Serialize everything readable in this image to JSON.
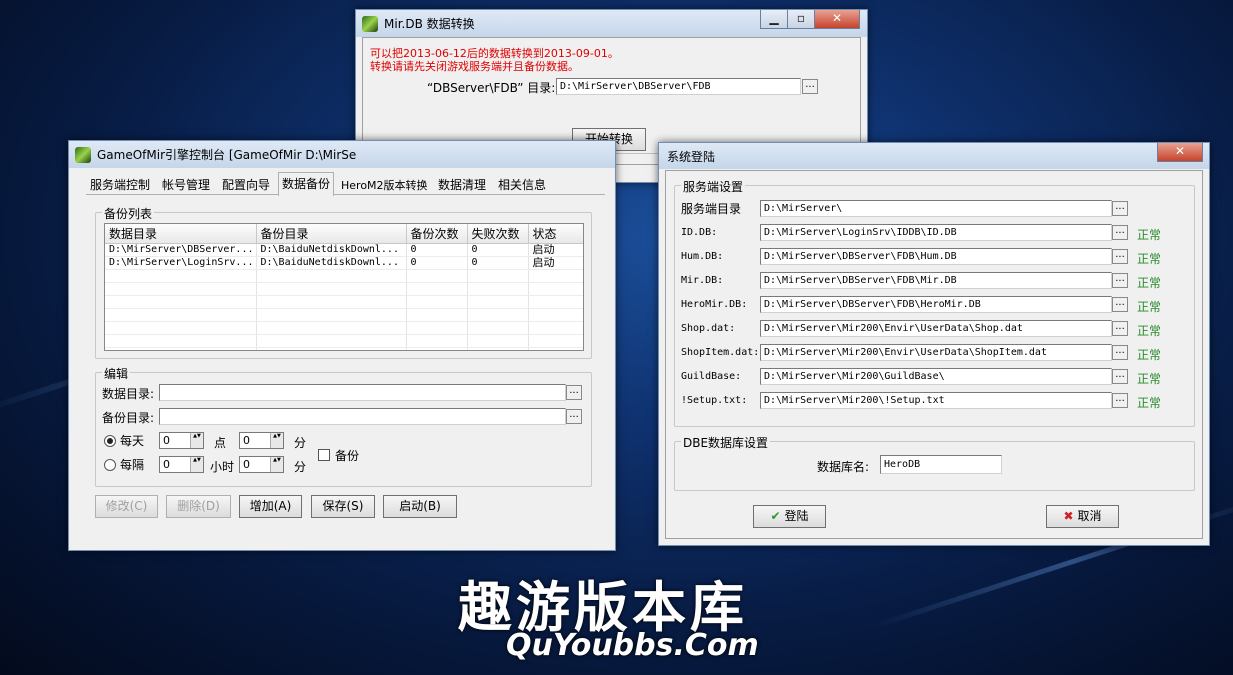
{
  "mirdb": {
    "title": "Mir.DB 数据转换",
    "notice_line1": "可以把2013-06-12后的数据转换到2013-09-01。",
    "notice_line2": "转换请请先关闭游戏服务端并且备份数据。",
    "dir_label": "“DBServer\\FDB” 目录:",
    "dir_value": "D:\\MirServer\\DBServer\\FDB",
    "browse": "...",
    "start_button": "开始转换"
  },
  "console": {
    "title": "GameOfMir引擎控制台 [GameOfMir D:\\MirSe",
    "tabs": [
      "服务端控制",
      "帐号管理",
      "配置向导",
      "数据备份",
      "HeroM2版本转换",
      "数据清理",
      "相关信息"
    ],
    "backup_list_title": "备份列表",
    "columns": [
      "数据目录",
      "备份目录",
      "备份次数",
      "失败次数",
      "状态"
    ],
    "rows": [
      [
        "D:\\MirServer\\DBServer...",
        "D:\\BaiduNetdiskDownl...",
        "0",
        "0",
        "启动"
      ],
      [
        "D:\\MirServer\\LoginSrv...",
        "D:\\BaiduNetdiskDownl...",
        "0",
        "0",
        "启动"
      ]
    ],
    "edit_title": "编辑",
    "data_dir_label": "数据目录:",
    "backup_dir_label": "备份目录:",
    "data_dir_value": "",
    "backup_dir_value": "",
    "daily_label": "每天",
    "interval_label": "每隔",
    "hour_label": "点",
    "hours_label": "小时",
    "minute_label": "分",
    "daily_hour": "0",
    "daily_minute": "0",
    "interval_hour": "0",
    "interval_minute": "0",
    "backup_check_label": "备份",
    "buttons": {
      "modify": "修改(C)",
      "delete": "删除(D)",
      "add": "增加(A)",
      "save": "保存(S)",
      "start": "启动(B)"
    }
  },
  "login": {
    "title": "系统登陆",
    "server_group": "服务端设置",
    "fields": [
      {
        "label": "服务端目录",
        "value": "D:\\MirServer\\",
        "status": ""
      },
      {
        "label": "ID.DB:",
        "value": "D:\\MirServer\\LoginSrv\\IDDB\\ID.DB",
        "status": "正常"
      },
      {
        "label": "Hum.DB:",
        "value": "D:\\MirServer\\DBServer\\FDB\\Hum.DB",
        "status": "正常"
      },
      {
        "label": "Mir.DB:",
        "value": "D:\\MirServer\\DBServer\\FDB\\Mir.DB",
        "status": "正常"
      },
      {
        "label": "HeroMir.DB:",
        "value": "D:\\MirServer\\DBServer\\FDB\\HeroMir.DB",
        "status": "正常"
      },
      {
        "label": "Shop.dat:",
        "value": "D:\\MirServer\\Mir200\\Envir\\UserData\\Shop.dat",
        "status": "正常"
      },
      {
        "label": "ShopItem.dat:",
        "value": "D:\\MirServer\\Mir200\\Envir\\UserData\\ShopItem.dat",
        "status": "正常"
      },
      {
        "label": "GuildBase:",
        "value": "D:\\MirServer\\Mir200\\GuildBase\\",
        "status": "正常"
      },
      {
        "label": "!Setup.txt:",
        "value": "D:\\MirServer\\Mir200\\!Setup.txt",
        "status": "正常"
      }
    ],
    "db_group": "DBE数据库设置",
    "db_name_label": "数据库名:",
    "db_name_value": "HeroDB",
    "login_button": "登陆",
    "cancel_button": "取消"
  },
  "watermark": {
    "cn": "趣游版本库",
    "en": "QuYoubbs.Com"
  },
  "colors": {
    "notice": "#e00000",
    "ok_status": "#2a8a2a"
  }
}
